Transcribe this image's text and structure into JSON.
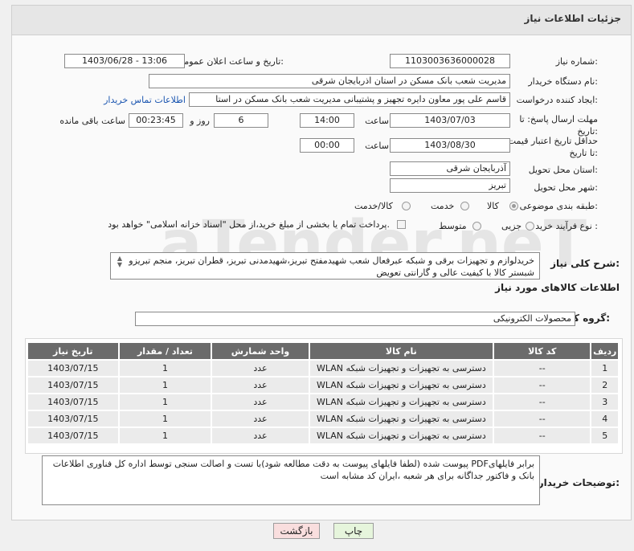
{
  "header": {
    "title": "جزئیات اطلاعات نیاز"
  },
  "form": {
    "need_number_label": "شماره نیاز:",
    "need_number": "1103003636000028",
    "announce_label": "تاریخ و ساعت اعلان عمومی:",
    "announce_value": "1403/06/28 - 13:06",
    "buyer_org_label": "نام دستگاه خریدار:",
    "buyer_org": "مدیریت شعب بانک مسکن در استان اذربایجان شرقی",
    "requester_label": "ایجاد کننده درخواست:",
    "requester": "قاسم علی پور معاون دایره تجهیز و پشتیبانی مدیریت شعب بانک مسکن در استا",
    "contact_link": "اطلاعات تماس خریدار",
    "deadline_label": "مهلت ارسال پاسخ: تا تاریخ:",
    "deadline_date": "1403/07/03",
    "time_label": "ساعت",
    "deadline_time": "14:00",
    "days_value": "6",
    "days_label": "روز و",
    "remaining_time": "00:23:45",
    "remaining_label": "ساعت باقی مانده",
    "validity_label": "حداقل تاریخ اعتبار قیمت: تا تاریخ:",
    "validity_date": "1403/08/30",
    "validity_time_label": "ساعت",
    "validity_time": "00:00",
    "province_label": "استان محل تحویل:",
    "province": "آذربایجان شرقی",
    "city_label": "شهر محل تحویل:",
    "city": "تبریز",
    "category_label": "طبقه بندی موضوعی:",
    "category_options": [
      "کالا",
      "خدمت",
      "کالا/خدمت"
    ],
    "process_label": "نوع فرآیند خرید :",
    "process_options": [
      "جزیی",
      "متوسط"
    ],
    "process_note": "پرداخت تمام یا بخشی از مبلغ خرید،از محل \"اسناد خزانه اسلامی\" خواهد بود.",
    "description_label": "شرح کلی نیاز:",
    "description": "خریدلوازم و تجهیزات برقی و شبکه عبرفعال شعب شهیدمفتح تبریز،شهیدمدنی تبریز، قطران تبریز، منجم تبریزو شبستر کالا با کیفیت عالی و گارانتی تعویض"
  },
  "goods": {
    "section_title": "اطلاعات کالاهای مورد نیاز",
    "group_label": "گروه کالا:",
    "group_value": "محصولات الکترونیکی",
    "columns": [
      "ردیف",
      "کد کالا",
      "نام کالا",
      "واحد شمارش",
      "تعداد / مقدار",
      "تاریخ نیاز"
    ],
    "rows": [
      [
        "1",
        "--",
        "دسترسی به تجهیزات و تجهیزات شبکه WLAN",
        "عدد",
        "1",
        "1403/07/15"
      ],
      [
        "2",
        "--",
        "دسترسی به تجهیزات و تجهیزات شبکه WLAN",
        "عدد",
        "1",
        "1403/07/15"
      ],
      [
        "3",
        "--",
        "دسترسی به تجهیزات و تجهیزات شبکه WLAN",
        "عدد",
        "1",
        "1403/07/15"
      ],
      [
        "4",
        "--",
        "دسترسی به تجهیزات و تجهیزات شبکه WLAN",
        "عدد",
        "1",
        "1403/07/15"
      ],
      [
        "5",
        "--",
        "دسترسی به تجهیزات و تجهیزات شبکه WLAN",
        "عدد",
        "1",
        "1403/07/15"
      ]
    ]
  },
  "buyer_notes": {
    "label": "توضیحات خریدار:",
    "text": "برابر فایلهایPDF پیوست شده (لطفا فایلهای پیوست به دقت مطالعه شود)با تست و اصالت سنجی توسط اداره کل فناوری اطلاعات بانک و فاکتور جداگانه برای هر شعبه ،ایران کد مشابه است"
  },
  "buttons": {
    "print": "چاپ",
    "back": "بازگشت"
  },
  "watermark": {
    "text": "AriaTender.neT"
  },
  "colors": {
    "header_bg": "#e6e6e6",
    "table_header_bg": "#6b6b6b",
    "back_button_bg": "#f9dede",
    "print_button_bg": "#e6f5dc",
    "link": "#1a55b0"
  }
}
